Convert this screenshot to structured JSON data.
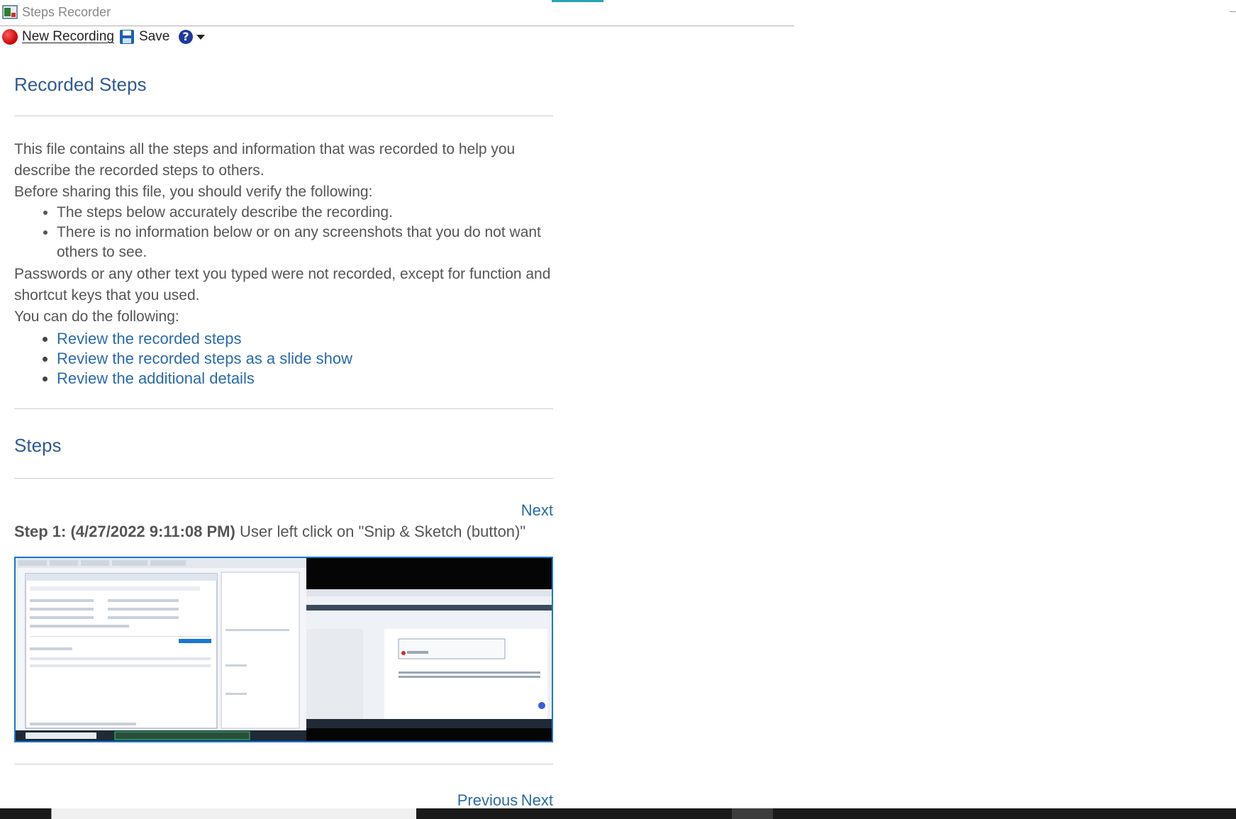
{
  "window": {
    "title": "Steps Recorder"
  },
  "toolbar": {
    "new_recording_label": "New Recording",
    "save_label": "Save",
    "help_glyph": "?"
  },
  "intro": {
    "heading": "Recorded Steps",
    "paragraph1": "This file contains all the steps and information that was recorded to help you describe the recorded steps to others.",
    "paragraph2": "Before sharing this file, you should verify the following:",
    "verify_items": [
      "The steps below accurately describe the recording.",
      "There is no information below or on any screenshots that you do not want others to see."
    ],
    "paragraph3": "Passwords or any other text you typed were not recorded, except for function and shortcut keys that you used.",
    "paragraph4": "You can do the following:",
    "links": [
      "Review the recorded steps",
      "Review the recorded steps as a slide show",
      "Review the additional details"
    ]
  },
  "steps_section": {
    "heading": "Steps",
    "next_label": "Next",
    "previous_label": "Previous",
    "step1": {
      "label": "Step 1: (4/27/2022 9:11:08 PM)",
      "description": "User left click on \"Snip & Sketch (button)\""
    }
  },
  "colors": {
    "heading": "#2e5a94",
    "link": "#2a6aa8",
    "screenshot_border": "#1976d2"
  }
}
